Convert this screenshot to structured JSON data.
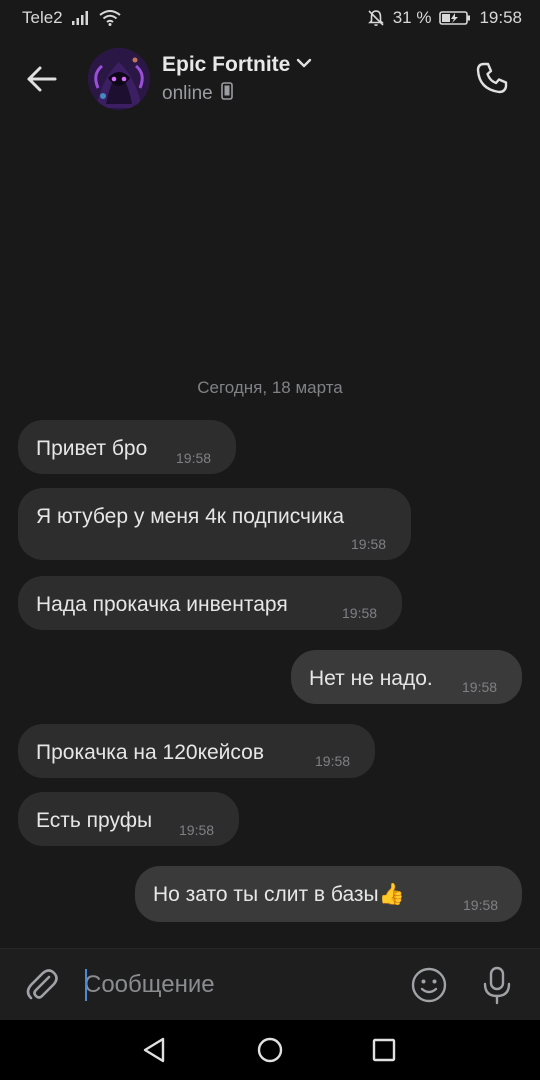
{
  "status_bar": {
    "carrier": "Tele2",
    "battery_percent": "31 %",
    "time": "19:58"
  },
  "header": {
    "title": "Epic Fortnite",
    "status": "online"
  },
  "date_separator": "Сегодня, 18 марта",
  "messages": [
    {
      "text": "Привет бро",
      "time": "19:58",
      "direction": "in"
    },
    {
      "text": "Я ютубер у меня 4к подписчика",
      "time": "19:58",
      "direction": "in"
    },
    {
      "text": "Нада прокачка инвентаря",
      "time": "19:58",
      "direction": "in"
    },
    {
      "text": "Нет не надо.",
      "time": "19:58",
      "direction": "out"
    },
    {
      "text": "Прокачка на 120кейсов",
      "time": "19:58",
      "direction": "in"
    },
    {
      "text": "Есть пруфы",
      "time": "19:58",
      "direction": "in"
    },
    {
      "text": "Но зато ты слит в базы👍",
      "time": "19:58",
      "direction": "out"
    }
  ],
  "composer": {
    "placeholder": "Сообщение"
  },
  "colors": {
    "background": "#191919",
    "bubble": "#2d2d2e",
    "accent_caret": "#4a8ad6"
  }
}
